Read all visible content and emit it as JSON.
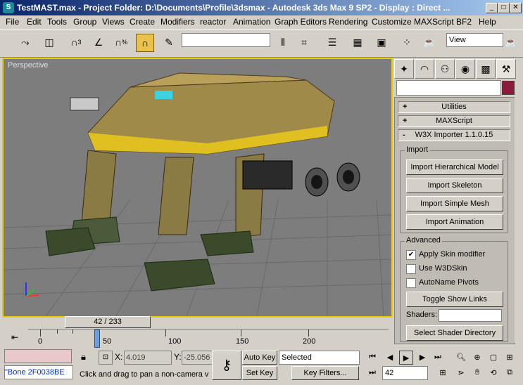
{
  "window": {
    "title": "TestMAST.max    - Project Folder: D:\\Documents\\Profile\\3dsmax    - Autodesk 3ds Max 9 SP2    - Display : Direct ...",
    "minimize": "_",
    "maximize": "□",
    "close": "✕"
  },
  "menu": [
    "File",
    "Edit",
    "Tools",
    "Group",
    "Views",
    "Create",
    "Modifiers",
    "reactor",
    "Animation",
    "Graph Editors",
    "Rendering",
    "Customize",
    "MAXScript",
    "BF2",
    "Help"
  ],
  "toolbar": {
    "view_combo": "View",
    "icons": [
      "select-link-icon",
      "unlink-icon",
      "snap-3d-icon",
      "angle-snap-icon",
      "percent-snap-icon",
      "spinner-snap-icon",
      "named-selection-icon",
      "mirror-icon",
      "align-icon",
      "layer-icon",
      "curve-editor-icon",
      "schematic-icon",
      "material-editor-icon",
      "render-scene-icon",
      "quick-render-icon"
    ],
    "snap_labels": {
      "snap": "3",
      "percent": "%"
    }
  },
  "viewport": {
    "label": "Perspective",
    "border_color": "#e8d000"
  },
  "command_panel": {
    "tabs": [
      "create-tab",
      "modify-tab",
      "hierarchy-tab",
      "motion-tab",
      "display-tab",
      "utilities-tab"
    ],
    "name_value": "",
    "color": "#8c1a3c",
    "rollouts": [
      {
        "sign": "+",
        "label": "Utilities"
      },
      {
        "sign": "+",
        "label": "MAXScript"
      },
      {
        "sign": "-",
        "label": "W3X Importer 1.1.0.15"
      }
    ],
    "import_group": {
      "title": "Import",
      "buttons": [
        "Import Hierarchical Model",
        "Import Skeleton",
        "Import Simple Mesh",
        "Import Animation"
      ]
    },
    "advanced_group": {
      "title": "Advanced",
      "checkboxes": [
        {
          "label": "Apply Skin modifier",
          "checked": true
        },
        {
          "label": "Use W3DSkin",
          "checked": false
        },
        {
          "label": "AutoName Pivots",
          "checked": false
        }
      ],
      "toggle_button": "Toggle Show Links",
      "shaders_label": "Shaders:",
      "shaders_value": "",
      "select_dir_button": "Select Shader Directory"
    }
  },
  "timeline": {
    "slider_text": "42 / 233",
    "current_frame": 42,
    "total_frames": 233,
    "labels": [
      "0",
      "50",
      "100",
      "150",
      "200"
    ]
  },
  "status": {
    "selection_box": "",
    "maxscript_listener": "\"Bone 2F0038BE",
    "lock_icon": "lock-icon",
    "x_label": "X:",
    "x_value": "4.019",
    "y_label": "Y:",
    "y_value": "-25.056",
    "prompt": "Click and drag to pan a non-camera v",
    "auto_key": "Auto Key",
    "set_key": "Set Key",
    "key_mode": "Selected",
    "key_filters": "Key Filters...",
    "frame": "42"
  }
}
